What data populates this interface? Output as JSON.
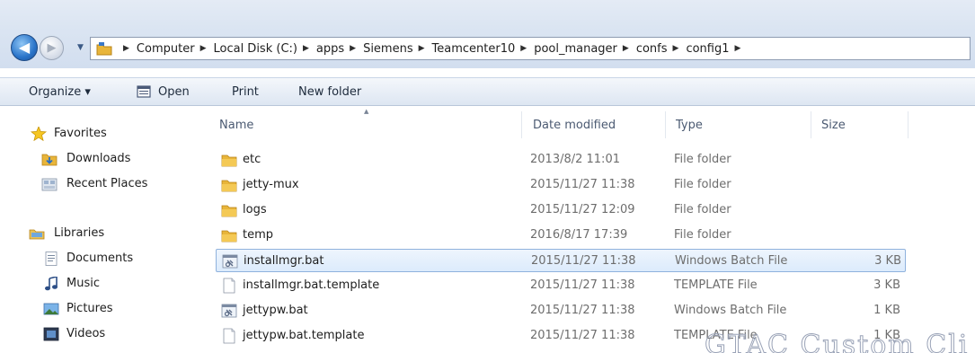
{
  "address_bar": {
    "crumbs": [
      "Computer",
      "Local Disk (C:)",
      "apps",
      "Siemens",
      "Teamcenter10",
      "pool_manager",
      "confs",
      "config1"
    ]
  },
  "toolbar": {
    "organize_label": "Organize ▾",
    "open_label": "Open",
    "print_label": "Print",
    "new_folder_label": "New folder"
  },
  "nav": {
    "favorites": "Favorites",
    "downloads": "Downloads",
    "recent_places": "Recent Places",
    "libraries": "Libraries",
    "documents": "Documents",
    "music": "Music",
    "pictures": "Pictures",
    "videos": "Videos"
  },
  "columns": {
    "name": "Name",
    "date": "Date modified",
    "type": "Type",
    "size": "Size"
  },
  "files": [
    {
      "name": "etc",
      "date": "2013/8/2 11:01",
      "type": "File folder",
      "size": "",
      "icon": "folder-icon"
    },
    {
      "name": "jetty-mux",
      "date": "2015/11/27 11:38",
      "type": "File folder",
      "size": "",
      "icon": "folder-icon"
    },
    {
      "name": "logs",
      "date": "2015/11/27 12:09",
      "type": "File folder",
      "size": "",
      "icon": "folder-icon"
    },
    {
      "name": "temp",
      "date": "2016/8/17 17:39",
      "type": "File folder",
      "size": "",
      "icon": "folder-icon"
    },
    {
      "name": "installmgr.bat",
      "date": "2015/11/27 11:38",
      "type": "Windows Batch File",
      "size": "3 KB",
      "icon": "batch-file-icon",
      "selected": true
    },
    {
      "name": "installmgr.bat.template",
      "date": "2015/11/27 11:38",
      "type": "TEMPLATE File",
      "size": "3 KB",
      "icon": "document-icon"
    },
    {
      "name": "jettypw.bat",
      "date": "2015/11/27 11:38",
      "type": "Windows Batch File",
      "size": "1 KB",
      "icon": "batch-file-icon"
    },
    {
      "name": "jettypw.bat.template",
      "date": "2015/11/27 11:38",
      "type": "TEMPLATE File",
      "size": "1 KB",
      "icon": "document-icon"
    }
  ],
  "colors": {
    "selection_border": "#8fb2dd",
    "selection_fill": "#dcebfc",
    "folder": "#e8b53a"
  }
}
